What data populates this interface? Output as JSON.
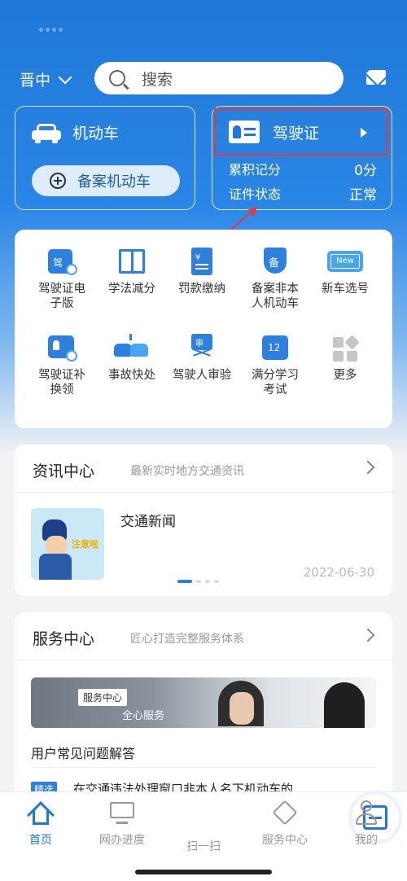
{
  "header": {
    "city": "晋中",
    "search_placeholder": "搜索"
  },
  "vehicle_card": {
    "title": "机动车",
    "record_button": "备案机动车"
  },
  "license_card": {
    "title": "驾驶证",
    "points_label": "累积记分",
    "points_value": "0分",
    "status_label": "证件状态",
    "status_value": "正常"
  },
  "services": [
    {
      "label": "驾驶证电\n子版",
      "icon": "e-license-icon"
    },
    {
      "label": "学法减分",
      "icon": "book-icon"
    },
    {
      "label": "罚款缴纳",
      "icon": "receipt-icon"
    },
    {
      "label": "备案非本\n人机动车",
      "icon": "shield-icon"
    },
    {
      "label": "新车选号",
      "icon": "new-plate-icon"
    },
    {
      "label": "驾驶证补\n换领",
      "icon": "license-replace-icon"
    },
    {
      "label": "事故快处",
      "icon": "accident-icon"
    },
    {
      "label": "驾驶人审验",
      "icon": "review-icon"
    },
    {
      "label": "满分学习\n考试",
      "icon": "calendar-12-icon"
    },
    {
      "label": "更多",
      "icon": "more-grid-icon"
    }
  ],
  "info_center": {
    "title": "资讯中心",
    "subtitle": "最新实时地方交通资讯",
    "news_title": "交通新闻",
    "news_date": "2022-06-30",
    "thumb_text": "注意啦"
  },
  "service_center": {
    "title": "服务中心",
    "subtitle": "匠心打造完整服务体系",
    "banner_tag": "服务中心",
    "banner_text": "全心服务",
    "faq": "用户常见问题解答",
    "featured_tag": "精选",
    "featured_text": "在交通违法处理窗口非本人名下机动车的"
  },
  "bottom_nav": [
    {
      "label": "首页",
      "icon": "home-icon",
      "active": true
    },
    {
      "label": "网办进度",
      "icon": "monitor-icon",
      "active": false
    },
    {
      "label": "扫一扫",
      "icon": "scan-icon",
      "active": false
    },
    {
      "label": "服务中心",
      "icon": "service-icon",
      "active": false
    },
    {
      "label": "我的",
      "icon": "user-icon",
      "active": false
    }
  ],
  "colors": {
    "brand_blue": "#1f78d8",
    "highlight_red": "#e23c3c"
  }
}
